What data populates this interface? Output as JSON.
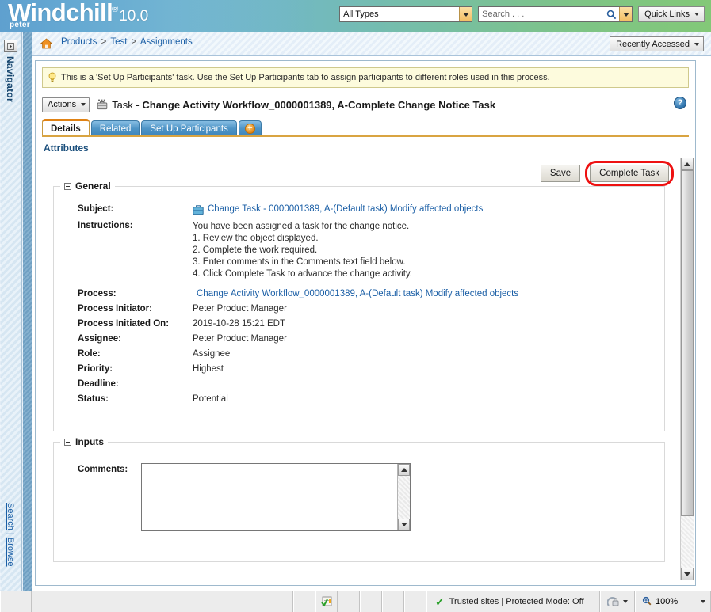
{
  "brand": {
    "name": "Windchill",
    "registered": "®",
    "version": "10.0",
    "username": "peter"
  },
  "header": {
    "type_filter": "All Types",
    "search_placeholder": "Search . . .",
    "quick_links": "Quick Links"
  },
  "navigator": {
    "title": "Navigator",
    "search_label": "Search",
    "separator": "|",
    "browse_label": "Browse"
  },
  "breadcrumb": {
    "items": [
      "Products",
      "Test",
      "Assignments"
    ],
    "separator": ">",
    "recently_accessed": "Recently Accessed"
  },
  "info_banner": {
    "message": "This is a 'Set Up Participants' task. Use the Set Up Participants tab to assign participants to different roles used in this process."
  },
  "task_header": {
    "actions_label": "Actions",
    "object_type": "Task - ",
    "object_name": "Change Activity Workflow_0000001389, A-Complete Change Notice Task"
  },
  "tabs": [
    {
      "label": "Details",
      "active": true
    },
    {
      "label": "Related",
      "active": false
    },
    {
      "label": "Set Up Participants",
      "active": false
    },
    {
      "label": "+",
      "active": false
    }
  ],
  "attributes_heading": "Attributes",
  "toolbar": {
    "save_label": "Save",
    "complete_task_label": "Complete Task"
  },
  "general": {
    "legend": "General",
    "subject_label": "Subject:",
    "subject_value": "Change Task - 0000001389, A-(Default task) Modify affected objects",
    "instructions_label": "Instructions:",
    "instructions_lines": [
      "You have been assigned a task for the change notice.",
      "1. Review the object displayed.",
      "2. Complete the work required.",
      "3. Enter comments in the Comments text field below.",
      "4. Click Complete Task to advance the change activity."
    ],
    "process_label": "Process:",
    "process_value": "Change Activity Workflow_0000001389, A-(Default task) Modify affected objects",
    "process_initiator_label": "Process Initiator:",
    "process_initiator_value": "Peter Product Manager",
    "process_initiated_on_label": "Process Initiated On:",
    "process_initiated_on_value": "2019-10-28 15:21 EDT",
    "assignee_label": "Assignee:",
    "assignee_value": "Peter Product Manager",
    "role_label": "Role:",
    "role_value": "Assignee",
    "priority_label": "Priority:",
    "priority_value": "Highest",
    "deadline_label": "Deadline:",
    "deadline_value": "",
    "status_label": "Status:",
    "status_value": "Potential"
  },
  "inputs": {
    "legend": "Inputs",
    "comments_label": "Comments:",
    "comments_value": ""
  },
  "statusbar": {
    "zone_text": "Trusted sites | Protected Mode: Off",
    "zoom_level": "100%"
  },
  "colors": {
    "accent_orange": "#e08214",
    "tab_blue": "#4e94c6",
    "link_blue": "#1b5fa6",
    "highlight_red": "#ee1111",
    "banner_yellow": "#fdfbdd"
  }
}
